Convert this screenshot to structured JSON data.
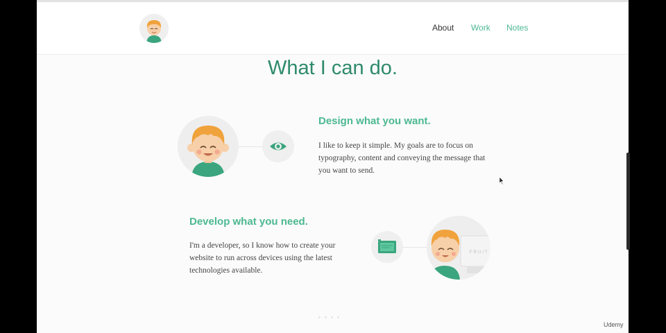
{
  "nav": {
    "about": "About",
    "work": "Work",
    "notes": "Notes"
  },
  "page": {
    "title": "What I can do."
  },
  "features": {
    "design": {
      "title": "Design what you want.",
      "text": "I like to keep it simple. My goals are to focus on typography, content and conveying the message that you want to send.",
      "icon": "eye-icon"
    },
    "develop": {
      "title": "Develop what you need.",
      "text": "I'm a developer, so I know how to create your website to run across devices using the latest technologies available.",
      "icon": "monitor-icon",
      "device_label": "FRUIT"
    }
  },
  "pager": "• • • •",
  "watermark": "Udemy",
  "colors": {
    "accent": "#4cb891",
    "title": "#2e8a6a",
    "hair": "#f0a23c",
    "shirt": "#3aa57e",
    "skin": "#f7cfa8"
  }
}
